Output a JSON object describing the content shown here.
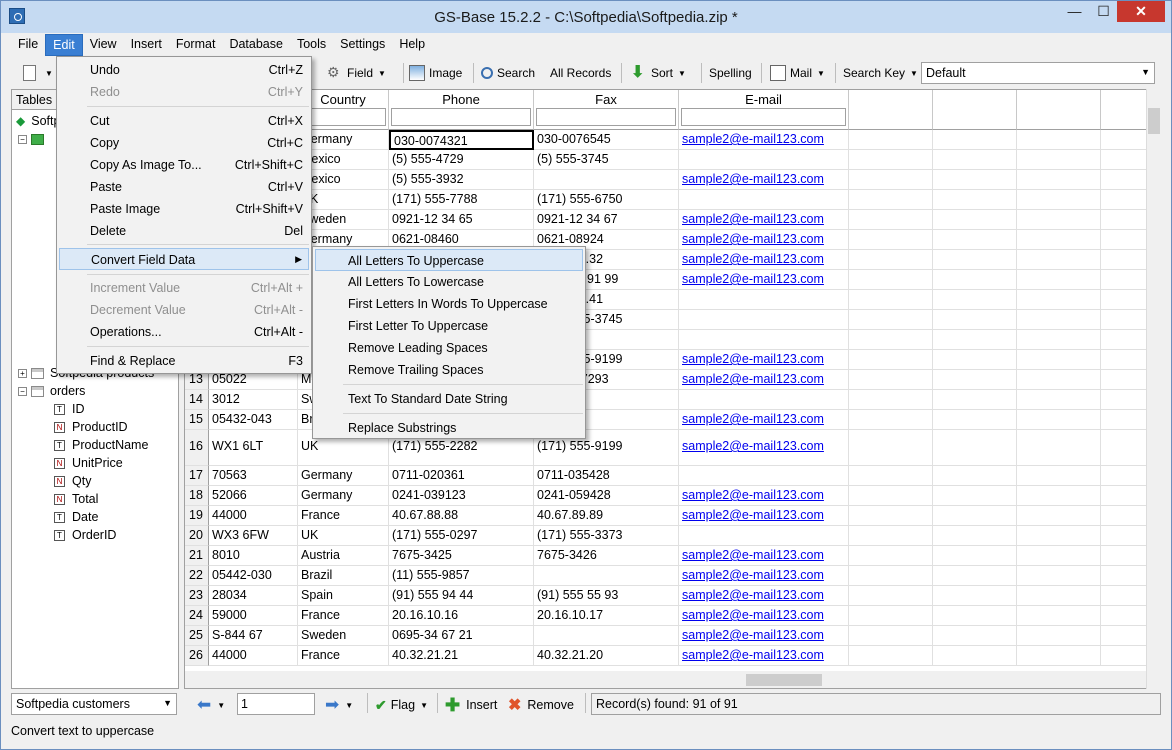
{
  "window": {
    "title": "GS-Base 15.2.2 - C:\\Softpedia\\Softpedia.zip *",
    "min": "—",
    "max": "☐",
    "close": "✕"
  },
  "menubar": [
    "File",
    "Edit",
    "View",
    "Insert",
    "Format",
    "Database",
    "Tools",
    "Settings",
    "Help"
  ],
  "toolbar": {
    "field": "Field",
    "image": "Image",
    "search": "Search",
    "all_records": "All Records",
    "sort": "Sort",
    "spelling": "Spelling",
    "mail": "Mail",
    "search_key": "Search Key",
    "search_key_value": "Default"
  },
  "tables_panel": {
    "header": "Tables",
    "root": "Softpedia",
    "tables": [
      "Softpedia products",
      "orders"
    ],
    "order_fields": [
      "ID",
      "ProductID",
      "ProductName",
      "UnitPrice",
      "Qty",
      "Total",
      "Date",
      "OrderID"
    ],
    "order_field_types": [
      "T",
      "N",
      "T",
      "N",
      "N",
      "N",
      "T",
      "T"
    ]
  },
  "grid": {
    "columns": [
      "Country",
      "Phone",
      "Fax",
      "E-mail"
    ],
    "rows_top": [
      {
        "country": "Germany",
        "phone": "030-0074321",
        "fax": "030-0076545",
        "email": "sample2@e-mail123.com"
      },
      {
        "country": "Mexico",
        "phone": "(5) 555-4729",
        "fax": "(5) 555-3745",
        "email": ""
      },
      {
        "country": "Mexico",
        "phone": "(5) 555-3932",
        "fax": "",
        "email": "sample2@e-mail123.com"
      },
      {
        "country": "UK",
        "phone": "(171) 555-7788",
        "fax": "(171) 555-6750",
        "email": ""
      },
      {
        "country": "Sweden",
        "phone": "0921-12 34 65",
        "fax": "0921-12 34 67",
        "email": "sample2@e-mail123.com"
      },
      {
        "country": "Germany",
        "phone": "0621-08460",
        "fax": "0621-08924",
        "email": "sample2@e-mail123.com"
      },
      {
        "country": "",
        "phone": "",
        "fax": "88.60.15.32",
        "email": "sample2@e-mail123.com"
      },
      {
        "country": "",
        "phone": "",
        "fax": "(91) 555 91 99",
        "email": "sample2@e-mail123.com"
      },
      {
        "country": "",
        "phone": "",
        "fax": "91.24.45.41",
        "email": ""
      },
      {
        "country": "",
        "phone": "",
        "fax": "(604) 555-3745",
        "email": ""
      },
      {
        "country": "",
        "phone": "",
        "fax": "",
        "email": ""
      },
      {
        "country": "",
        "phone": "",
        "fax": "(171) 555-9199",
        "email": "sample2@e-mail123.com"
      }
    ],
    "rows": [
      {
        "n": "13",
        "zip": "05022",
        "country": "Mexico",
        "phone": "",
        "fax": "(5) 555-7293",
        "email": "sample2@e-mail123.com"
      },
      {
        "n": "14",
        "zip": "3012",
        "country": "Switzerland",
        "phone": "",
        "fax": "",
        "email": ""
      },
      {
        "n": "15",
        "zip": "05432-043",
        "country": "Brazil",
        "phone": "",
        "fax": "",
        "email": "sample2@e-mail123.com"
      },
      {
        "n": "16",
        "zip": "WX1 6LT",
        "country": "UK",
        "phone": "(171) 555-2282",
        "fax": "(171) 555-9199",
        "email": "sample2@e-mail123.com"
      },
      {
        "n": "17",
        "zip": "70563",
        "country": "Germany",
        "phone": "0711-020361",
        "fax": "0711-035428",
        "email": ""
      },
      {
        "n": "18",
        "zip": "52066",
        "country": "Germany",
        "phone": "0241-039123",
        "fax": "0241-059428",
        "email": "sample2@e-mail123.com"
      },
      {
        "n": "19",
        "zip": "44000",
        "country": "France",
        "phone": "40.67.88.88",
        "fax": "40.67.89.89",
        "email": "sample2@e-mail123.com"
      },
      {
        "n": "20",
        "zip": "WX3 6FW",
        "country": "UK",
        "phone": "(171) 555-0297",
        "fax": "(171) 555-3373",
        "email": ""
      },
      {
        "n": "21",
        "zip": "8010",
        "country": "Austria",
        "phone": "7675-3425",
        "fax": "7675-3426",
        "email": "sample2@e-mail123.com"
      },
      {
        "n": "22",
        "zip": "05442-030",
        "country": "Brazil",
        "phone": "(11) 555-9857",
        "fax": "",
        "email": "sample2@e-mail123.com"
      },
      {
        "n": "23",
        "zip": "28034",
        "country": "Spain",
        "phone": "(91) 555 94 44",
        "fax": "(91) 555 55 93",
        "email": "sample2@e-mail123.com"
      },
      {
        "n": "24",
        "zip": "59000",
        "country": "France",
        "phone": "20.16.10.16",
        "fax": "20.16.10.17",
        "email": "sample2@e-mail123.com"
      },
      {
        "n": "25",
        "zip": "S-844 67",
        "country": "Sweden",
        "phone": "0695-34 67 21",
        "fax": "",
        "email": "sample2@e-mail123.com"
      },
      {
        "n": "26",
        "zip": "44000",
        "country": "France",
        "phone": "40.32.21.21",
        "fax": "40.32.21.20",
        "email": "sample2@e-mail123.com"
      }
    ]
  },
  "edit_menu": {
    "items": [
      {
        "label": "Undo",
        "shortcut": "Ctrl+Z",
        "disabled": false
      },
      {
        "label": "Redo",
        "shortcut": "Ctrl+Y",
        "disabled": true
      },
      {
        "label": "Cut",
        "shortcut": "Ctrl+X",
        "disabled": false
      },
      {
        "label": "Copy",
        "shortcut": "Ctrl+C",
        "disabled": false
      },
      {
        "label": "Copy As Image To...",
        "shortcut": "Ctrl+Shift+C",
        "disabled": false
      },
      {
        "label": "Paste",
        "shortcut": "Ctrl+V",
        "disabled": false
      },
      {
        "label": "Paste Image",
        "shortcut": "Ctrl+Shift+V",
        "disabled": false
      },
      {
        "label": "Delete",
        "shortcut": "Del",
        "disabled": false
      },
      {
        "label": "Convert Field Data",
        "shortcut": "",
        "disabled": false
      },
      {
        "label": "Increment Value",
        "shortcut": "Ctrl+Alt +",
        "disabled": true
      },
      {
        "label": "Decrement Value",
        "shortcut": "Ctrl+Alt -",
        "disabled": true
      },
      {
        "label": "Operations...",
        "shortcut": "Ctrl+Alt -",
        "disabled": false
      },
      {
        "label": "Find & Replace",
        "shortcut": "F3",
        "disabled": false
      }
    ]
  },
  "convert_submenu": [
    "All Letters To Uppercase",
    "All Letters To Lowercase",
    "First Letters In Words To Uppercase",
    "First Letter To Uppercase",
    "Remove Leading Spaces",
    "Remove Trailing Spaces",
    "Text To Standard Date String",
    "Replace Substrings"
  ],
  "bottom": {
    "table_select": "Softpedia customers",
    "record_input": "1",
    "flag": "Flag",
    "insert": "Insert",
    "remove": "Remove",
    "records_found": "Record(s) found: 91 of 91"
  },
  "status": "Convert text to uppercase"
}
